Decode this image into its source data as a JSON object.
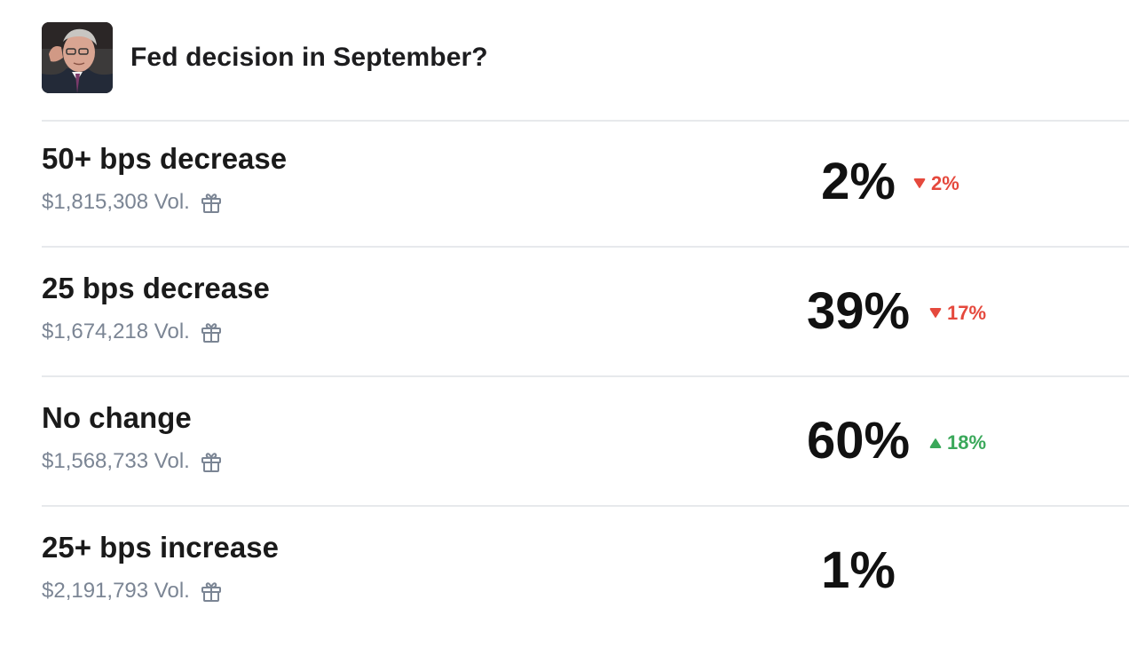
{
  "market": {
    "title": "Fed decision in September?"
  },
  "outcomes": [
    {
      "name": "50+ bps decrease",
      "volume": "$1,815,308 Vol.",
      "probability": "2%",
      "change": "2%",
      "direction": "down"
    },
    {
      "name": "25 bps decrease",
      "volume": "$1,674,218 Vol.",
      "probability": "39%",
      "change": "17%",
      "direction": "down"
    },
    {
      "name": "No change",
      "volume": "$1,568,733 Vol.",
      "probability": "60%",
      "change": "18%",
      "direction": "up"
    },
    {
      "name": "25+ bps increase",
      "volume": "$2,191,793 Vol.",
      "probability": "1%",
      "change": "",
      "direction": "none"
    }
  ],
  "colors": {
    "down": "#e5493d",
    "up": "#3aa85a",
    "muted": "#7b8594"
  }
}
